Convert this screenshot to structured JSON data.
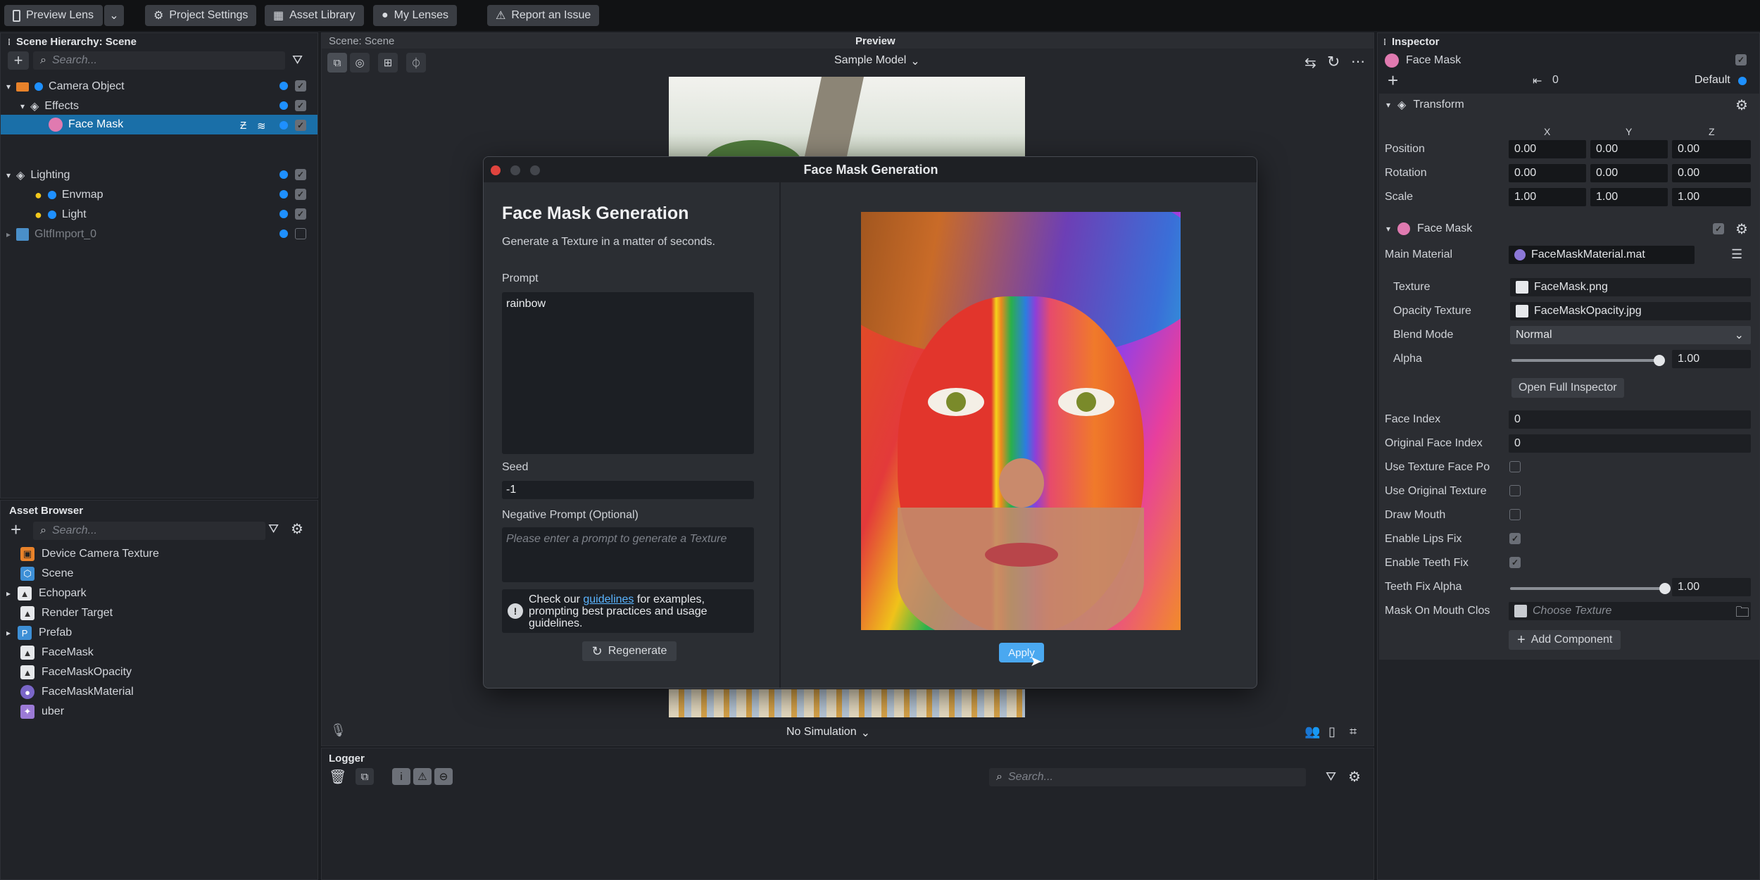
{
  "toolbar": {
    "preview_lens": "Preview Lens",
    "project_settings": "Project Settings",
    "asset_library": "Asset Library",
    "my_lenses": "My Lenses",
    "report_issue": "Report an Issue"
  },
  "hierarchy": {
    "title": "Scene Hierarchy: Scene",
    "search_placeholder": "Search...",
    "items": [
      "Camera Object",
      "Effects",
      "Face Mask",
      "Lighting",
      "Envmap",
      "Light",
      "GltfImport_0"
    ]
  },
  "assets": {
    "title": "Asset Browser",
    "search_placeholder": "Search...",
    "items": [
      "Device Camera Texture",
      "Scene",
      "Echopark",
      "Render Target",
      "Prefab",
      "FaceMask",
      "FaceMaskOpacity",
      "FaceMaskMaterial",
      "uber"
    ]
  },
  "scene": {
    "title": "Scene: Scene"
  },
  "preview": {
    "title": "Preview",
    "model": "Sample Model",
    "simulation": "No Simulation"
  },
  "logger": {
    "title": "Logger",
    "search_placeholder": "Search..."
  },
  "dialog": {
    "window_title": "Face Mask Generation",
    "heading": "Face Mask Generation",
    "subtitle": "Generate a Texture in a matter of seconds.",
    "prompt_label": "Prompt",
    "prompt_value": "rainbow",
    "seed_label": "Seed",
    "seed_value": "-1",
    "neg_label": "Negative Prompt (Optional)",
    "neg_placeholder": "Please enter a prompt to generate a Texture",
    "tip_pre": "Check our ",
    "tip_link": "guidelines",
    "tip_post": " for examples, prompting best practices and usage guidelines.",
    "regenerate": "Regenerate",
    "apply": "Apply"
  },
  "inspector": {
    "title": "Inspector",
    "object_name": "Face Mask",
    "layer_value": "0",
    "layer_name": "Default",
    "transform": {
      "title": "Transform",
      "axes": [
        "X",
        "Y",
        "Z"
      ],
      "rows": [
        {
          "label": "Position",
          "values": [
            "0.00",
            "0.00",
            "0.00"
          ]
        },
        {
          "label": "Rotation",
          "values": [
            "0.00",
            "0.00",
            "0.00"
          ]
        },
        {
          "label": "Scale",
          "values": [
            "1.00",
            "1.00",
            "1.00"
          ]
        }
      ]
    },
    "face_mask": {
      "title": "Face Mask",
      "main_material_label": "Main Material",
      "main_material": "FaceMaskMaterial.mat",
      "texture_label": "Texture",
      "texture": "FaceMask.png",
      "opacity_label": "Opacity Texture",
      "opacity": "FaceMaskOpacity.jpg",
      "blend_label": "Blend Mode",
      "blend": "Normal",
      "alpha_label": "Alpha",
      "alpha": "1.00",
      "alpha_level": 1.0,
      "open_full": "Open Full Inspector",
      "face_index_label": "Face Index",
      "face_index": "0",
      "orig_face_index_label": "Original Face Index",
      "orig_face_index": "0",
      "use_tex_face_pos": "Use Texture Face Po",
      "use_orig_tex": "Use Original Texture",
      "draw_mouth": "Draw Mouth",
      "lips_fix": "Enable Lips Fix",
      "teeth_fix": "Enable Teeth Fix",
      "teeth_alpha_label": "Teeth Fix Alpha",
      "teeth_alpha": "1.00",
      "teeth_alpha_level": 1.0,
      "mask_mouth_label": "Mask On Mouth Clos",
      "mask_mouth_placeholder": "Choose Texture"
    },
    "add_component": "Add Component"
  },
  "colors": {
    "accent": "#1e90ff",
    "selection": "#1a6fa8",
    "apply_button": "#4aa8f0"
  }
}
